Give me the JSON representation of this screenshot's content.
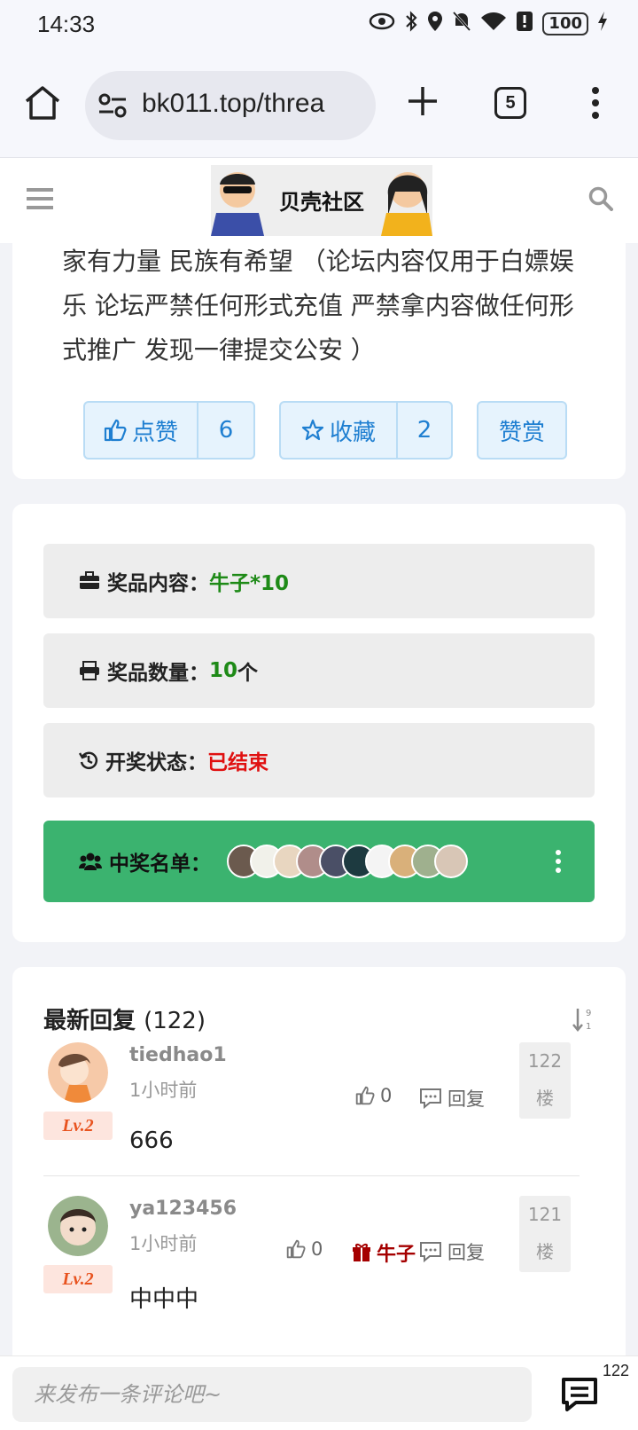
{
  "status_bar": {
    "time": "14:33",
    "battery": "100"
  },
  "browser": {
    "url": "bk011.top/threa",
    "tab_count": "5"
  },
  "site": {
    "logo_text": "贝壳社区"
  },
  "post": {
    "text": "家有力量 民族有希望 （论坛内容仅用于白嫖娱乐 论坛严禁任何形式充值 严禁拿内容做任何形式推广 发现一律提交公安 ）",
    "like_label": "点赞",
    "like_count": "6",
    "fav_label": "收藏",
    "fav_count": "2",
    "reward_label": "赞赏"
  },
  "lottery": {
    "prize_label": "奖品内容：",
    "prize_value": "牛子*10",
    "qty_label": "奖品数量：",
    "qty_value": "10",
    "qty_unit": " 个",
    "status_label": "开奖状态：",
    "status_value": "已结束",
    "winners_label": "中奖名单：",
    "colors": {
      "row_bg": "#ededed",
      "winners_bg": "#3bb36f",
      "value_green": "#1e8a17",
      "status_red": "#e01010"
    }
  },
  "replies": {
    "title": "最新回复",
    "count": "(122)",
    "items": [
      {
        "user": "tiedhao1",
        "time": "1小时前",
        "level": "Lv.2",
        "content": "666",
        "likes": "0",
        "reply_label": "回复",
        "floor_num": "122",
        "floor_unit": "楼",
        "gift": ""
      },
      {
        "user": "ya123456",
        "time": "1小时前",
        "level": "Lv.2",
        "content": "中中中",
        "likes": "0",
        "reply_label": "回复",
        "floor_num": "121",
        "floor_unit": "楼",
        "gift": "牛子"
      }
    ]
  },
  "comment_bar": {
    "placeholder": "来发布一条评论吧~",
    "count": "122"
  }
}
